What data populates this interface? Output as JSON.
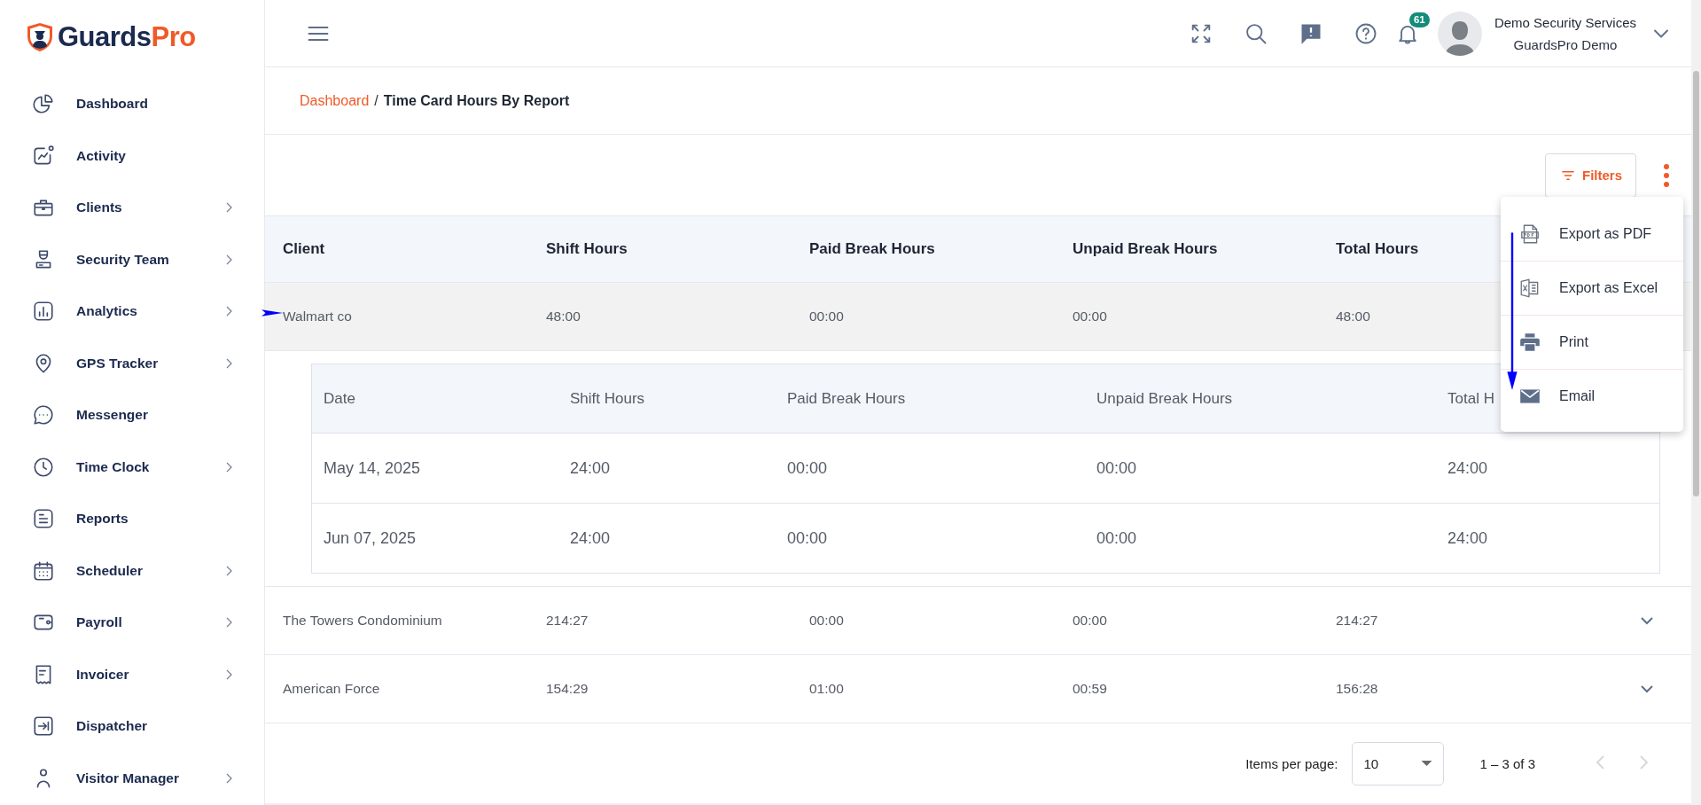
{
  "sidebar": {
    "logo": {
      "brand": "Guards",
      "accent": "Pro"
    },
    "items": [
      {
        "label": "Dashboard",
        "expandable": false
      },
      {
        "label": "Activity",
        "expandable": false
      },
      {
        "label": "Clients",
        "expandable": true
      },
      {
        "label": "Security Team",
        "expandable": true
      },
      {
        "label": "Analytics",
        "expandable": true
      },
      {
        "label": "GPS Tracker",
        "expandable": true
      },
      {
        "label": "Messenger",
        "expandable": false
      },
      {
        "label": "Time Clock",
        "expandable": true
      },
      {
        "label": "Reports",
        "expandable": false
      },
      {
        "label": "Scheduler",
        "expandable": true
      },
      {
        "label": "Payroll",
        "expandable": true
      },
      {
        "label": "Invoicer",
        "expandable": true
      },
      {
        "label": "Dispatcher",
        "expandable": false
      },
      {
        "label": "Visitor Manager",
        "expandable": true
      }
    ]
  },
  "header": {
    "notification_count": "61",
    "user": {
      "name": "Demo Security Services",
      "org": "GuardsPro Demo"
    }
  },
  "breadcrumb": {
    "link": "Dashboard",
    "separator": "/",
    "current": "Time Card Hours By Report"
  },
  "toolbar": {
    "filters": "Filters"
  },
  "menu": {
    "items": [
      {
        "label": "Export as PDF"
      },
      {
        "label": "Export as Excel"
      },
      {
        "label": "Print"
      },
      {
        "label": "Email"
      }
    ]
  },
  "table": {
    "columns": [
      "Client",
      "Shift Hours",
      "Paid Break Hours",
      "Unpaid Break Hours",
      "Total Hours"
    ],
    "rows": [
      {
        "cells": [
          "Walmart co",
          "48:00",
          "00:00",
          "00:00",
          "48:00"
        ],
        "expanded": true,
        "details": {
          "columns": [
            "Date",
            "Shift Hours",
            "Paid Break Hours",
            "Unpaid Break Hours",
            "Total H"
          ],
          "rows": [
            [
              "May 14, 2025",
              "24:00",
              "00:00",
              "00:00",
              "24:00"
            ],
            [
              "Jun 07, 2025",
              "24:00",
              "00:00",
              "00:00",
              "24:00"
            ]
          ]
        }
      },
      {
        "cells": [
          "The Towers Condominium",
          "214:27",
          "00:00",
          "00:00",
          "214:27"
        ],
        "expanded": false
      },
      {
        "cells": [
          "American Force",
          "154:29",
          "01:00",
          "00:59",
          "156:28"
        ],
        "expanded": false
      }
    ]
  },
  "pagination": {
    "label": "Items per page:",
    "page_size": "10",
    "range": "1 – 3 of 3",
    "prev_disabled": true,
    "next_disabled": true
  }
}
